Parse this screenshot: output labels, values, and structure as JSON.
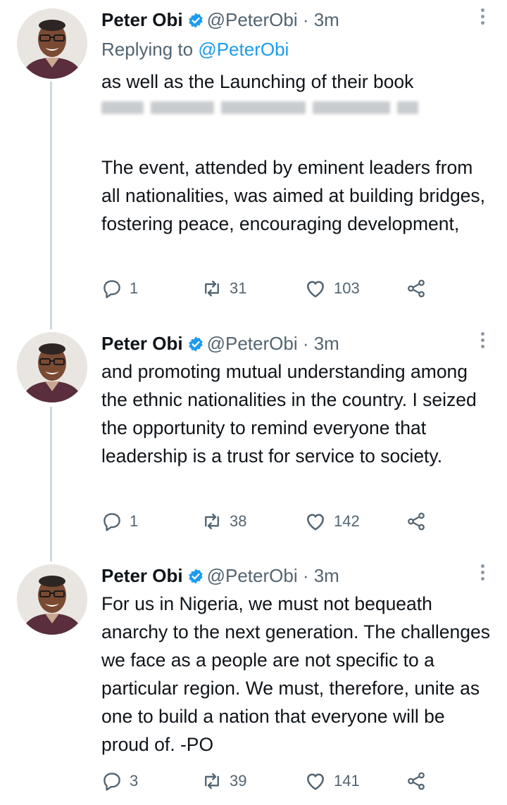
{
  "tweets": [
    {
      "name": "Peter Obi",
      "handle": "@PeterObi",
      "time": "· 3m",
      "replying_prefix": "Replying to ",
      "replying_handle": "@PeterObi",
      "paragraphs": [
        "as well as the Launching of their book",
        "The event, attended by eminent leaders from all nationalities, was aimed at building bridges, fostering peace, encouraging development,"
      ],
      "replies": "1",
      "retweets": "31",
      "likes": "103"
    },
    {
      "name": "Peter Obi",
      "handle": "@PeterObi",
      "time": "· 3m",
      "paragraphs": [
        "and promoting mutual understanding among the ethnic nationalities in the country. I seized the opportunity to remind everyone that leadership is a trust for service to society."
      ],
      "replies": "1",
      "retweets": "38",
      "likes": "142"
    },
    {
      "name": "Peter Obi",
      "handle": "@PeterObi",
      "time": "· 3m",
      "paragraphs": [
        "For us in Nigeria, we must not bequeath anarchy to the next generation. The challenges we face as a people are not specific to a particular region. We must, therefore, unite as one to build a nation that everyone will be proud of. -PO"
      ],
      "replies": "3",
      "retweets": "39",
      "likes": "141"
    }
  ],
  "icons": {
    "verified": "verified-badge-icon",
    "reply": "reply-icon",
    "retweet": "retweet-icon",
    "like": "heart-icon",
    "share": "share-icon",
    "more": "more-vertical-icon"
  },
  "colors": {
    "verified": "#1d9bf0",
    "link": "#1d9bf0",
    "secondary": "#536471",
    "thread_line": "#cfd9de"
  }
}
